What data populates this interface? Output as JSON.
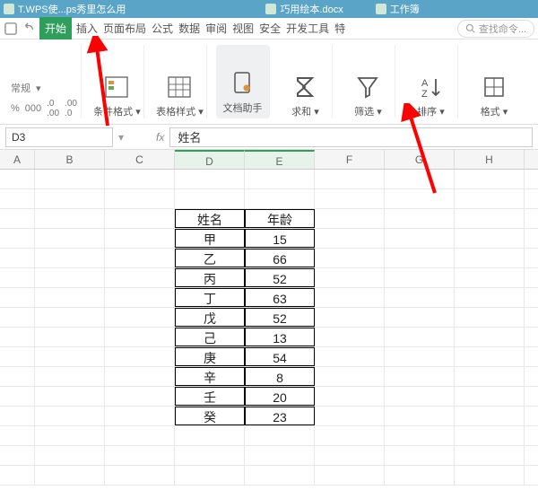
{
  "top_tabs": {
    "left_tab": "T.WPS使...ps秀里怎么用",
    "right_tab": "巧用绘本.docx",
    "more": "工作簿"
  },
  "menu": {
    "items": [
      "开始",
      "插入",
      "页面布局",
      "公式",
      "数据",
      "审阅",
      "视图",
      "安全",
      "开发工具",
      "特"
    ],
    "active_index": 0,
    "search_placeholder": "查找命令..."
  },
  "ribbon": {
    "format_label": "常规",
    "cond_fmt": "条件格式",
    "table_style": "表格样式",
    "doc_helper": "文档助手",
    "sum": "求和",
    "filter": "筛选",
    "sort": "排序",
    "format": "格式"
  },
  "addr": {
    "cell_ref": "D3",
    "fx": "fx",
    "formula": "姓名"
  },
  "columns": [
    "A",
    "B",
    "C",
    "D",
    "E",
    "F",
    "G",
    "H"
  ],
  "table": {
    "header": {
      "name": "姓名",
      "age": "年龄"
    },
    "rows": [
      {
        "name": "甲",
        "age": "15"
      },
      {
        "name": "乙",
        "age": "66"
      },
      {
        "name": "丙",
        "age": "52"
      },
      {
        "name": "丁",
        "age": "63"
      },
      {
        "name": "戊",
        "age": "52"
      },
      {
        "name": "己",
        "age": "13"
      },
      {
        "name": "庚",
        "age": "54"
      },
      {
        "name": "辛",
        "age": "8"
      },
      {
        "name": "壬",
        "age": "20"
      },
      {
        "name": "癸",
        "age": "23"
      }
    ]
  },
  "arrows": {
    "color": "#ff0000"
  }
}
